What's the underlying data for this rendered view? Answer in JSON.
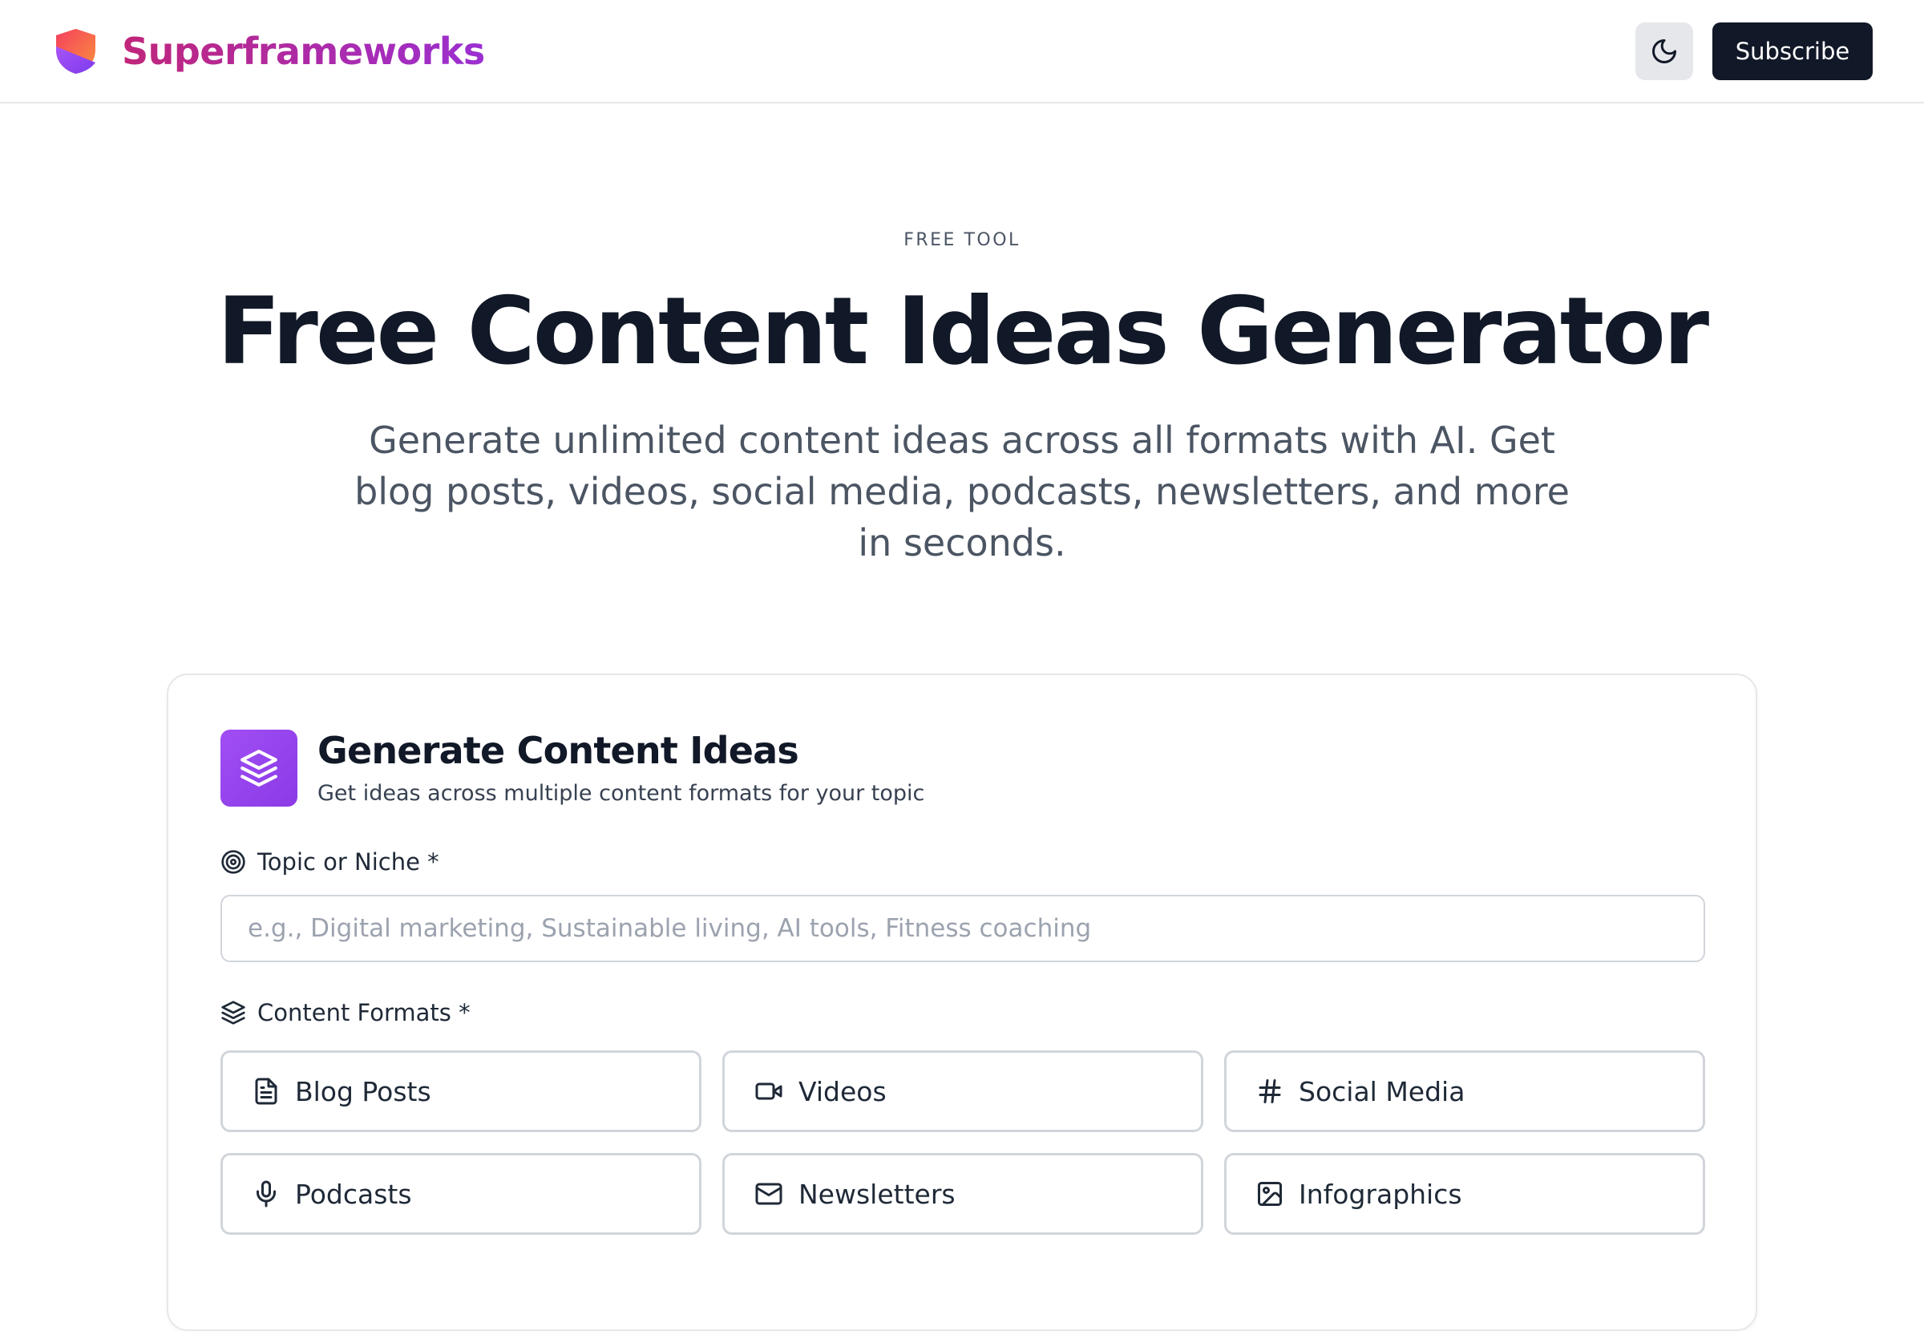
{
  "header": {
    "brand_name": "Superframeworks",
    "theme_toggle_icon": "moon-icon",
    "subscribe_label": "Subscribe"
  },
  "hero": {
    "eyebrow": "FREE TOOL",
    "title": "Free Content Ideas Generator",
    "subtitle": "Generate unlimited content ideas across all formats with AI. Get blog posts, videos, social media, podcasts, newsletters, and more in seconds."
  },
  "card": {
    "title": "Generate Content Ideas",
    "subtitle": "Get ideas across multiple content formats for your topic",
    "icon": "layers-icon",
    "topic": {
      "label": "Topic or Niche *",
      "icon": "target-icon",
      "value": "",
      "placeholder": "e.g., Digital marketing, Sustainable living, AI tools, Fitness coaching"
    },
    "formats": {
      "label": "Content Formats *",
      "icon": "layers-icon",
      "items": [
        {
          "label": "Blog Posts",
          "icon": "file-text-icon"
        },
        {
          "label": "Videos",
          "icon": "video-icon"
        },
        {
          "label": "Social Media",
          "icon": "hash-icon"
        },
        {
          "label": "Podcasts",
          "icon": "mic-icon"
        },
        {
          "label": "Newsletters",
          "icon": "mail-icon"
        },
        {
          "label": "Infographics",
          "icon": "image-icon"
        }
      ]
    }
  },
  "colors": {
    "brand_gradient_start": "#c0267a",
    "brand_gradient_end": "#9b2fd1",
    "card_icon_bg": "#9b45f0",
    "primary_button_bg": "#111827",
    "border": "#d1d5db",
    "muted_text": "#4b5563"
  }
}
